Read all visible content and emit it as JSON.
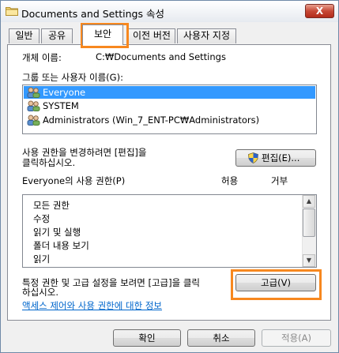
{
  "window": {
    "title": "Documents and Settings 속성",
    "close_glyph": "X"
  },
  "tabs": [
    {
      "label": "일반"
    },
    {
      "label": "공유"
    },
    {
      "label": "보안"
    },
    {
      "label": "이전 버전"
    },
    {
      "label": "사용자 지정"
    }
  ],
  "security": {
    "object_name_label": "개체 이름:",
    "object_name_value": "C:₩Documents and Settings",
    "groups_label": "그룹 또는 사용자 이름(G):",
    "groups": [
      {
        "name": "Everyone",
        "selected": true
      },
      {
        "name": "SYSTEM",
        "selected": false
      },
      {
        "name": "Administrators (Win_7_ENT-PC₩Administrators)",
        "selected": false
      }
    ],
    "change_perm_text_line1": "사용 권한을 변경하려면 [편집]을",
    "change_perm_text_line2": "클릭하십시오.",
    "edit_button": "편집(E)...",
    "perm_header": "Everyone의 사용 권한(P)",
    "allow_header": "허용",
    "deny_header": "거부",
    "permissions": [
      "모든 권한",
      "수정",
      "읽기 및 실행",
      "폴더 내용 보기",
      "읽기",
      "쓰기"
    ],
    "advanced_text_line1": "특정 권한 및 고급 설정을 보려면 [고급]을 클릭",
    "advanced_text_line2": "하십시오.",
    "advanced_button": "고급(V)",
    "help_link": "액세스 제어와 사용 권한에 대한 정보"
  },
  "footer": {
    "ok": "확인",
    "cancel": "취소",
    "apply": "적용(A)"
  },
  "colors": {
    "highlight": "#f7881f",
    "selection": "#3399ff",
    "link": "#0066cc"
  }
}
